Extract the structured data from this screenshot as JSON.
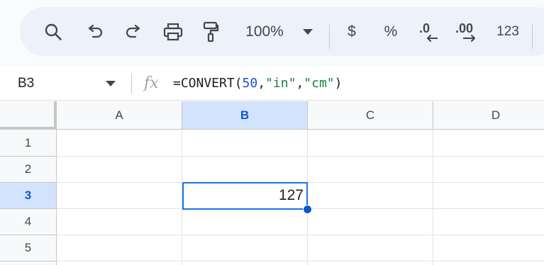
{
  "toolbar": {
    "zoom": "100%",
    "currency_label": "$",
    "percent_label": "%",
    "number_format_label": "123",
    "icons": [
      "search-icon",
      "undo-icon",
      "redo-icon",
      "print-icon",
      "paint-format-icon",
      "chevron-down-icon",
      "decrease-decimal-icon",
      "increase-decimal-icon"
    ]
  },
  "formula_bar": {
    "cell_ref": "B3",
    "fx_label": "fx",
    "formula_prefix": "=CONVERT(",
    "arg_number": "50",
    "sep1": ",",
    "arg_from": "\"in\"",
    "sep2": ",",
    "arg_to": "\"cm\"",
    "formula_suffix": ")"
  },
  "sheet": {
    "columns": [
      "A",
      "B",
      "C",
      "D"
    ],
    "rows": [
      "1",
      "2",
      "3",
      "4",
      "5"
    ],
    "selected_column": "B",
    "selected_row": "3",
    "cells": {
      "B3": "127"
    }
  },
  "colors": {
    "selection_blue": "#1a73e8",
    "header_selected_bg": "#d3e3fd",
    "formula_number": "#1155cc",
    "formula_string": "#188038"
  }
}
